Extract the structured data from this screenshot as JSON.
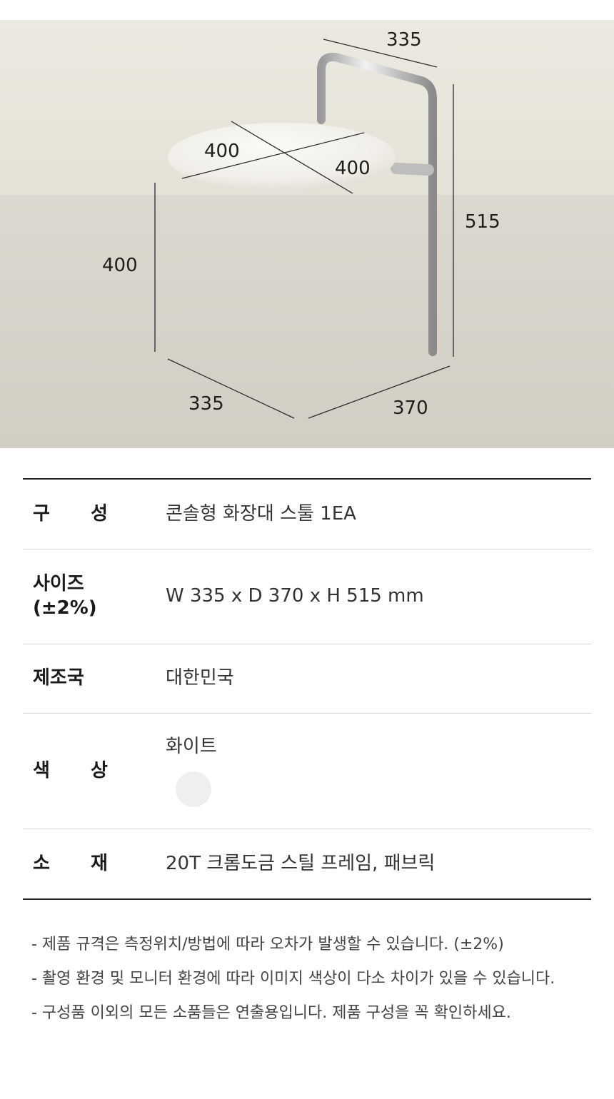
{
  "dimensions": {
    "backrest_width": "335",
    "seat_a": "400",
    "seat_b": "400",
    "total_height": "515",
    "seat_height": "400",
    "base_width": "335",
    "base_depth": "370"
  },
  "spec": {
    "rows": [
      {
        "label": "구 성",
        "value": "콘솔형 화장대 스툴 1EA"
      },
      {
        "label": "사이즈\n(±2%)",
        "value": "W 335 x D 370 x H 515 mm"
      },
      {
        "label": "제조국",
        "value": "대한민국"
      },
      {
        "label": "색 상",
        "value": "화이트",
        "swatch_color": "#efefef"
      },
      {
        "label": "소 재",
        "value": "20T 크롬도금 스틸 프레임, 패브릭"
      }
    ]
  },
  "notes": [
    "- 제품 규격은 측정위치/방법에 따라 오차가 발생할 수 있습니다. (±2%)",
    "- 촬영 환경 및 모니터 환경에 따라 이미지 색상이 다소 차이가 있을 수 있습니다.",
    "- 구성품 이외의 모든 소품들은 연출용입니다. 제품 구성을 꼭 확인하세요."
  ]
}
